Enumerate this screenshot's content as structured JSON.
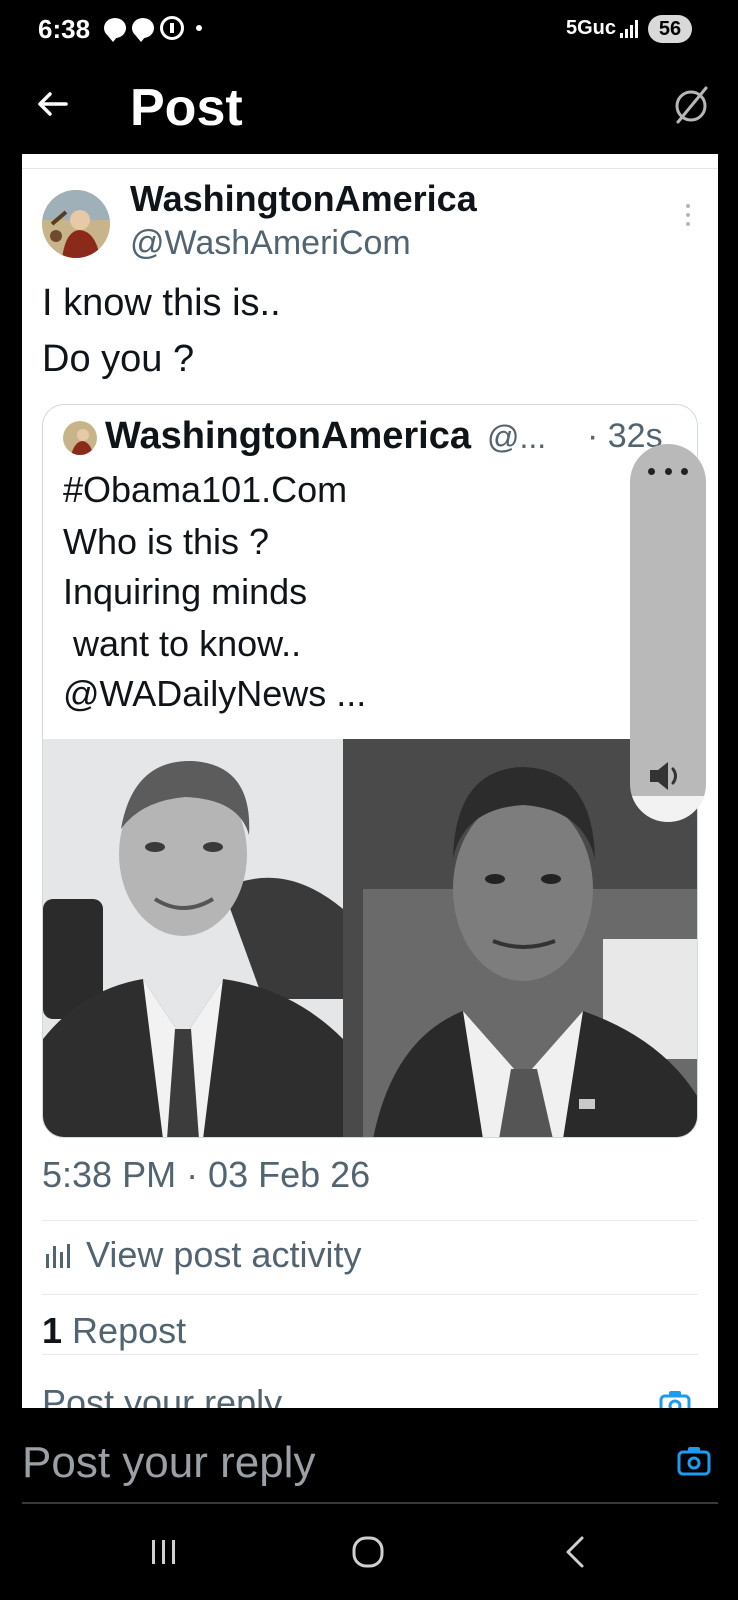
{
  "status_bar": {
    "time": "6:38",
    "network": "5Guc",
    "battery": "56"
  },
  "header": {
    "title": "Post"
  },
  "post": {
    "display_name": "WashingtonAmerica",
    "handle": "@WashAmeriCom",
    "lines": [
      "I know this is..",
      "Do you ?"
    ],
    "timestamp": "5:38 PM · 03 Feb 26",
    "activity_label": "View post activity",
    "repost_count": "1",
    "repost_label": "Repost"
  },
  "quoted_post": {
    "display_name": "WashingtonAmerica",
    "handle": "@...",
    "time": "· 32s",
    "lines": [
      "#Obama101.Com",
      "Who is this ?",
      "Inquiring minds",
      " want to know..",
      "@WADailyNews ..."
    ]
  },
  "reply": {
    "placeholder": "Post your reply",
    "ghost_placeholder": "Post your reply"
  },
  "icons": {
    "back": "arrow-left-icon",
    "header_action": "circle-slash-icon",
    "more": "more-vertical-icon",
    "volume": "speaker-icon",
    "activity": "bar-chart-icon",
    "camera": "camera-icon",
    "nav": [
      "recents-icon",
      "home-icon",
      "back-icon"
    ]
  },
  "colors": {
    "accent": "#1d9bf0",
    "secondary_text": "#536471",
    "background": "#000000"
  }
}
